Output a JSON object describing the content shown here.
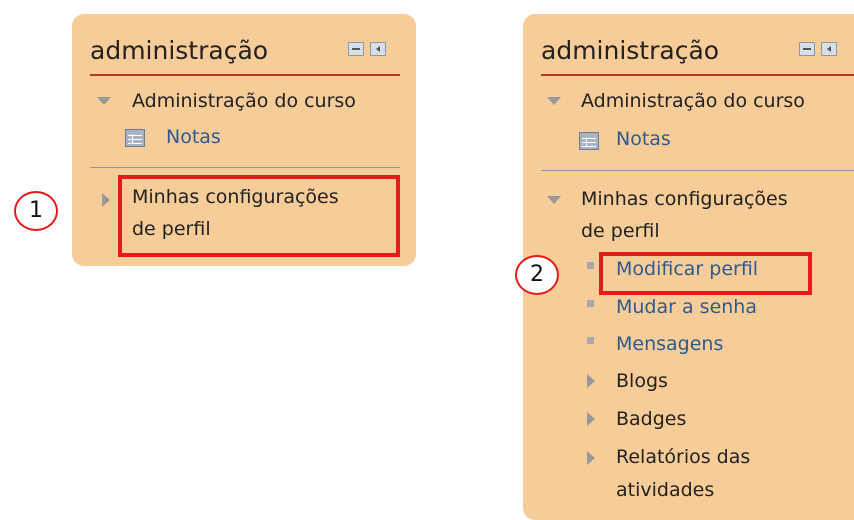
{
  "left_panel": {
    "title": "administração",
    "section_course": "Administração do curso",
    "grades_link": "Notas",
    "section_profile": "Minhas configurações de perfil",
    "section_profile_line1": "Minhas configurações",
    "section_profile_line2": "de perfil",
    "step_marker": "1"
  },
  "right_panel": {
    "title": "administração",
    "section_course": "Administração do curso",
    "grades_link": "Notas",
    "section_profile_line1": "Minhas configurações",
    "section_profile_line2": "de perfil",
    "items": [
      {
        "label": "Modificar perfil"
      },
      {
        "label": "Mudar a senha"
      },
      {
        "label": "Mensagens"
      },
      {
        "label": "Blogs"
      },
      {
        "label": "Badges"
      },
      {
        "label": "Relatórios das"
      },
      {
        "label": "atividades"
      }
    ],
    "step_marker": "2"
  },
  "colors": {
    "block_bg": "#f6cc98",
    "link": "#2e5a8f",
    "highlight": "#e31b1b",
    "header_rule": "#b8391f"
  },
  "icons": {
    "collapse": "minus-box-icon",
    "dock": "dock-left-icon",
    "grades": "grid-table-icon",
    "expanded": "triangle-down-icon",
    "collapsed": "triangle-right-icon",
    "leaf": "square-bullet-icon"
  }
}
